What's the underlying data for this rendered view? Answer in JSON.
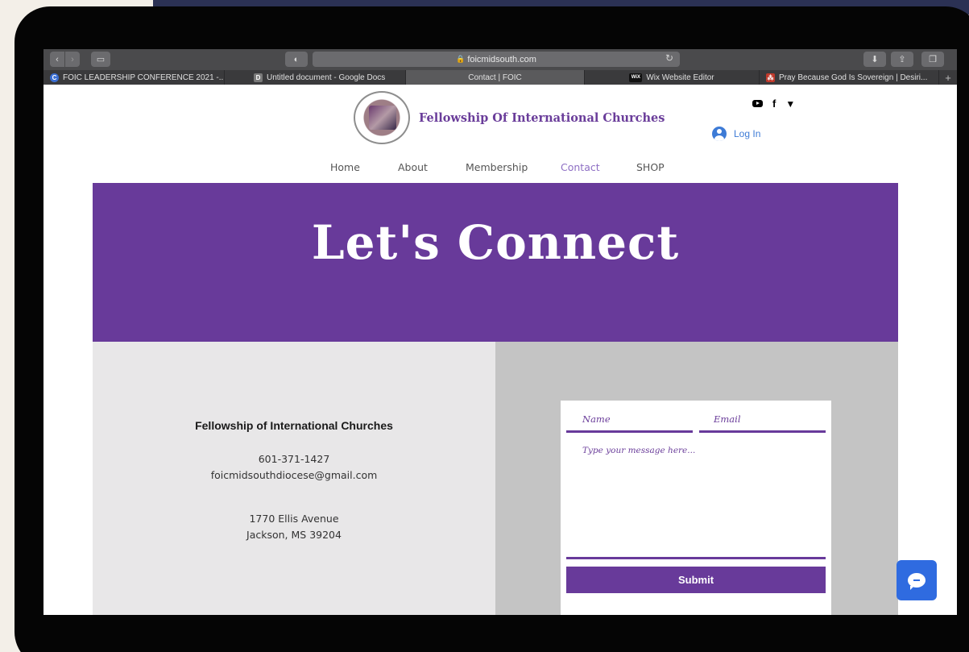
{
  "browser": {
    "url": "foicmidsouth.com",
    "tabs": [
      {
        "label": "FOIC LEADERSHIP CONFERENCE 2021 -...",
        "favicon": "C",
        "favicon_color": "#3b6fd4"
      },
      {
        "label": "Untitled document - Google Docs",
        "favicon": "D",
        "favicon_color": "#7a7a7a"
      },
      {
        "label": "Contact | FOIC",
        "favicon": "",
        "favicon_color": ""
      },
      {
        "label": "Wix Website Editor",
        "favicon": "WiX",
        "favicon_color": "#111111"
      },
      {
        "label": "Pray Because God Is Sovereign | Desiri...",
        "favicon": "⁂",
        "favicon_color": "#c0392b"
      }
    ],
    "new_tab_label": "+"
  },
  "site": {
    "brand": "Fellowship Of International Churches",
    "login_label": "Log In",
    "social": {
      "youtube": "youtube-icon",
      "facebook": "f",
      "twitter": "🐦"
    },
    "nav": {
      "home": "Home",
      "about": "About",
      "membership": "Membership",
      "contact": "Contact",
      "shop": "SHOP"
    },
    "hero_title": "Let's Connect"
  },
  "contact": {
    "org_name": "Fellowship of International Churches",
    "phone": "601-371-1427",
    "email": "foicmidsouthdiocese@gmail.com",
    "street": "1770 Ellis Avenue",
    "city": "Jackson, MS 39204"
  },
  "form": {
    "name_placeholder": "Name",
    "email_placeholder": "Email",
    "message_placeholder": "Type your message here...",
    "submit_label": "Submit"
  },
  "colors": {
    "brand_purple": "#683a9a",
    "link_blue": "#3d7bd6",
    "chat_blue": "#2f6be0"
  }
}
